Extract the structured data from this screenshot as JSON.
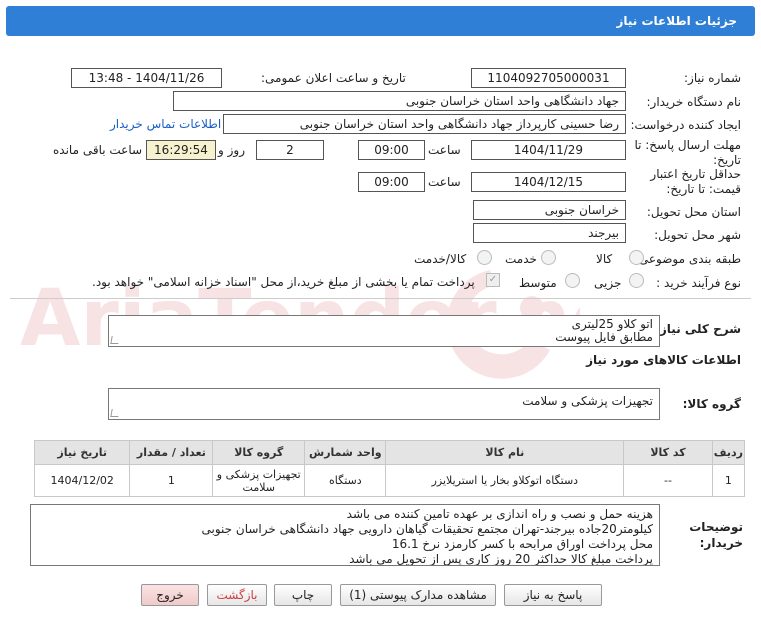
{
  "header": {
    "title": "جزئیات اطلاعات نیاز"
  },
  "fields": {
    "need_number_label": "شماره نیاز:",
    "need_number": "1104092705000031",
    "announce_label": "تاریخ و ساعت اعلان عمومی:",
    "announce_value": "1404/11/26 - 13:48",
    "buyer_org_label": "نام دستگاه خریدار:",
    "buyer_org": "جهاد دانشگاهی واحد استان خراسان جنوبی",
    "creator_label": "ایجاد کننده درخواست:",
    "creator": "رضا حسینی کارپرداز جهاد دانشگاهی واحد استان خراسان جنوبی",
    "contact_link": "اطلاعات تماس خریدار",
    "deadline_label_1": "مهلت ارسال پاسخ: تا",
    "deadline_label_2": "تاریخ:",
    "deadline_date": "1404/11/29",
    "time_label": "ساعت",
    "deadline_time": "09:00",
    "days_value": "2",
    "days_label": "روز و",
    "remaining_time": "16:29:54",
    "remaining_label": "ساعت باقی مانده",
    "validity_label_1": "حداقل تاریخ اعتبار",
    "validity_label_2": "قیمت: تا تاریخ:",
    "validity_date": "1404/12/15",
    "validity_time": "09:00",
    "province_label": "استان محل تحویل:",
    "province": "خراسان جنوبی",
    "city_label": "شهر محل تحویل:",
    "city": "بیرجند",
    "category_label": "طبقه بندی موضوعی:",
    "category_options": [
      "کالا",
      "خدمت",
      "کالا/خدمت"
    ],
    "purchase_type_label": "نوع فرآیند خرید :",
    "purchase_options": [
      "جزیی",
      "متوسط"
    ],
    "payment_note": "پرداخت تمام یا بخشی از مبلغ خرید،از محل \"اسناد خزانه اسلامی\" خواهد بود."
  },
  "description": {
    "label": "شرح کلی نیاز:",
    "line1": "اتو کلاو 25لیتری",
    "line2": "مطابق فایل پیوست"
  },
  "goods_section_title": "اطلاعات کالاهای مورد نیاز",
  "goods_group": {
    "label": "گروه کالا:",
    "value": "تجهیزات پزشکی و سلامت"
  },
  "table": {
    "headers": [
      "ردیف",
      "کد کالا",
      "نام کالا",
      "واحد شمارش",
      "گروه کالا",
      "تعداد / مقدار",
      "تاریخ نیاز"
    ],
    "rows": [
      [
        "1",
        "--",
        "دستگاه اتوکلاو بخار یا استریلایزر",
        "دستگاه",
        "تجهیزات پزشکی و سلامت",
        "1",
        "1404/12/02"
      ]
    ]
  },
  "notes": {
    "label_1": "توضیحات",
    "label_2": "خریدار:",
    "lines": [
      "هزینه حمل و نصب و راه اندازی بر عهده تامین کننده می باشد",
      "کیلومتر20جاده بیرجند-تهران مجتمع تحقیقات گیاهان دارویی جهاد دانشگاهی خراسان جنوبی",
      "محل پرداخت اوراق مرابحه با کسر کارمزد نرخ 16.1",
      "پرداخت مبلغ کالا حداکثر 20 روز کاری پس از تحویل می باشد"
    ]
  },
  "buttons": {
    "reply": "پاسخ به نیاز",
    "docs": "مشاهده مدارک پیوستی (1)",
    "print": "چاپ",
    "back": "بازگشت",
    "exit": "خروج"
  },
  "watermark": {
    "text": "AriaTender.net"
  },
  "colors": {
    "header": "#2f7fd6",
    "link": "#1a5fc8",
    "remaining_bg": "#f6f2cf",
    "back_btn_text": "#d04040"
  }
}
